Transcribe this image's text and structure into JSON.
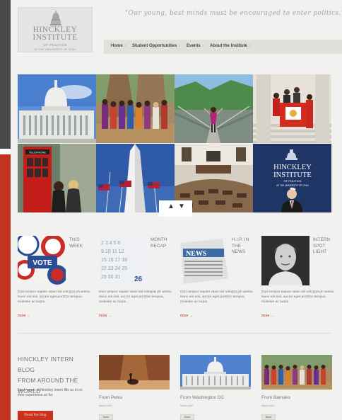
{
  "header": {
    "logo": {
      "line1": "HINCKLEY",
      "line2": "INSTITUTE",
      "line3": "OF POLITICS",
      "line4": "AT THE UNIVERSITY OF UTAH"
    },
    "quote": "\"Our young, best minds must be encouraged to enter politics.\""
  },
  "nav": {
    "items": [
      {
        "label": "Home"
      },
      {
        "label": "Student Opportunities"
      },
      {
        "label": "Events"
      },
      {
        "label": "About the Institute"
      }
    ]
  },
  "grid": {
    "poster": {
      "line1": "HINCKLEY",
      "line2": "INSTITUTE",
      "line3": "OF POLITICS",
      "line4": "AT THE UNIVERSITY OF UTAH"
    },
    "arrow_up": "▲",
    "arrow_down": "▼",
    "sign_text": "TELEPHONE",
    "vote_text": "VOTE",
    "news_text": "NEWS"
  },
  "features": [
    {
      "label_line1": "THIS",
      "label_line2": "WEEK",
      "label_line3": "",
      "desc": "Duis tempor sapien vitae nisl volutpat ph aretra. Nunc est nisl, auctor eget porttitor tempus, molestie ac turpis.",
      "more": "more →"
    },
    {
      "label_line1": "MONTH",
      "label_line2": "RECAP",
      "label_line3": "",
      "desc": "Duis tempor sapien vitae nisl volutpat ph aretra. Nunc est nisl, auctor eget porttitor tempus, molestie ac turpis.",
      "more": "more →"
    },
    {
      "label_line1": "H.I.P. IN",
      "label_line2": "THE",
      "label_line3": "NEWS",
      "desc": "Duis tempor sapien vitae nisl volutpat ph aretra. Nunc est nisl, auctor eget porttitor tempus, molestie ac turpis.",
      "more": "more →"
    },
    {
      "label_line1": "INTERN",
      "label_line2": "SPOT",
      "label_line3": "LIGHT",
      "desc": "Duis tempor sapien vitae nisl volutpat ph aretra. Nunc est nisl, auctor eget porttitor tempus, molestie ac turpis.",
      "more": "more →"
    }
  ],
  "blog": {
    "title_line1": "HINCKLEY INTERN BLOG",
    "title_line2": "FROM AROUND THE",
    "title_line3": "WORLD",
    "desc": "Each week, a Hinckley intern fills us in on their experience so far.",
    "button": "Read the blog",
    "posts": [
      {
        "title": "From Petra",
        "date": "March 2010",
        "more": "More"
      },
      {
        "title": "From Washington DC",
        "date": "March 2010",
        "more": "More"
      },
      {
        "title": "From Bamako",
        "date": "March 2010",
        "more": "More"
      }
    ]
  },
  "colors": {
    "accent": "#c4331f",
    "dark_bar": "#4a4a4a",
    "page_bg": "#f1f1ef"
  }
}
